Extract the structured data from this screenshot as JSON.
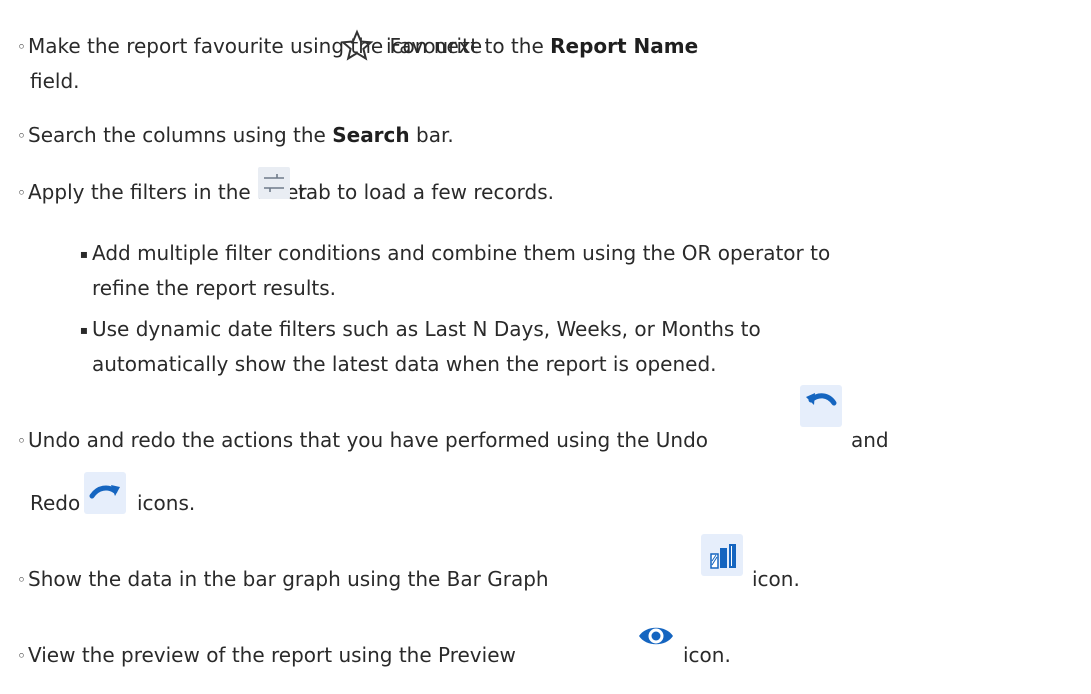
{
  "items": {
    "favourite": {
      "bullet": "◦",
      "pre": "Make the report favourite using the Favourite",
      "mid": "icon next to the",
      "bold": "Report Name",
      "cont": "field.",
      "icon": "star-outline-icon"
    },
    "search": {
      "bullet": "◦",
      "pre": "Search the columns using the",
      "bold": "Search",
      "post": "bar."
    },
    "filter": {
      "bullet": "◦",
      "pre": "Apply the filters in the Filter",
      "post": "tab to load a few records.",
      "icon": "filter-sliders-icon",
      "sub": [
        {
          "bullet": "▪",
          "line1": "Add multiple filter conditions and combine them using the OR operator to",
          "line2": "refine the report results."
        },
        {
          "bullet": "▪",
          "line1": "Use dynamic date filters such as Last N Days, Weeks, or Months to",
          "line2": "automatically show the latest data when the report is opened."
        }
      ]
    },
    "undoredo": {
      "bullet": "◦",
      "pre": "Undo and redo the actions that you have performed using the Undo",
      "and": "and",
      "redo": "Redo",
      "post": "icons.",
      "undo_icon": "undo-icon",
      "redo_icon": "redo-icon"
    },
    "bargraph": {
      "bullet": "◦",
      "pre": "Show the data in the bar graph using the Bar Graph",
      "post": "icon.",
      "icon": "bar-graph-icon"
    },
    "preview": {
      "bullet": "◦",
      "pre": "View the preview of the report using the Preview",
      "post": "icon.",
      "icon": "eye-icon"
    }
  },
  "colors": {
    "text": "#2a2a2a",
    "icon_blue": "#1565c0",
    "icon_bg": "#e6eefb"
  }
}
